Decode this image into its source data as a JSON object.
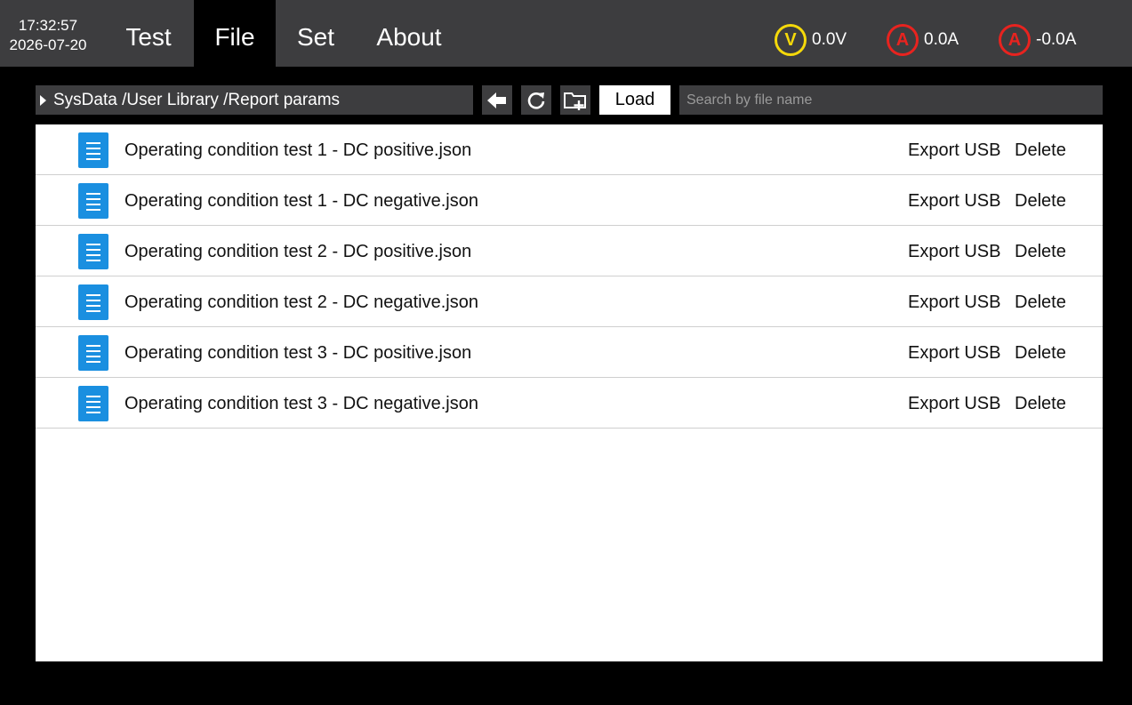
{
  "status": {
    "time": "17:32:57",
    "date": "2026-07-20"
  },
  "tabs": [
    {
      "label": "Test",
      "active": false
    },
    {
      "label": "File",
      "active": true
    },
    {
      "label": "Set",
      "active": false
    },
    {
      "label": "About",
      "active": false
    }
  ],
  "meters": [
    {
      "symbol": "V",
      "value": "0.0V",
      "color": "#f5d90a"
    },
    {
      "symbol": "A",
      "value": "0.0A",
      "color": "#e8231f"
    },
    {
      "symbol": "A",
      "value": "-0.0A",
      "color": "#e8231f"
    }
  ],
  "toolbar": {
    "path": "SysData /User Library /Report params",
    "load_label": "Load",
    "search_placeholder": "Search by file name",
    "icons": [
      "back-arrow-icon",
      "refresh-icon",
      "new-folder-icon"
    ]
  },
  "files": [
    {
      "name": "Operating condition test 1 - DC positive.json",
      "export": "Export USB",
      "delete": "Delete"
    },
    {
      "name": "Operating condition test 1 - DC negative.json",
      "export": "Export USB",
      "delete": "Delete"
    },
    {
      "name": "Operating condition test 2 - DC positive.json",
      "export": "Export USB",
      "delete": "Delete"
    },
    {
      "name": "Operating condition test 2 - DC negative.json",
      "export": "Export USB",
      "delete": "Delete"
    },
    {
      "name": "Operating condition test 3 - DC positive.json",
      "export": "Export USB",
      "delete": "Delete"
    },
    {
      "name": "Operating condition test 3 - DC negative.json",
      "export": "Export USB",
      "delete": "Delete"
    }
  ]
}
